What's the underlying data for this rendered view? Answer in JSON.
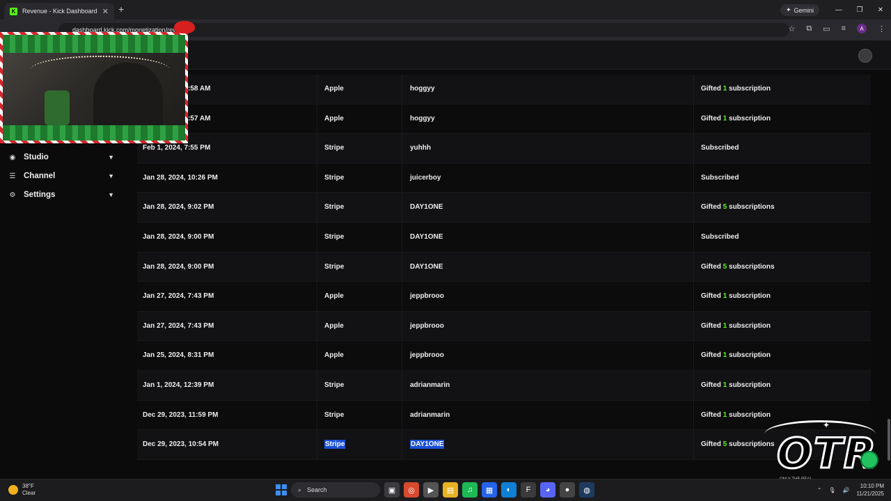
{
  "browser": {
    "tab_title": "Revenue - Kick Dashboard",
    "tab_favicon": "K",
    "url": "dashboard.kick.com/monetization/revenue",
    "gemini_label": "Gemini",
    "profile_initial": "A"
  },
  "sidebar": {
    "items": [
      {
        "label": "Studio",
        "icon": "studio-icon"
      },
      {
        "label": "Channel",
        "icon": "channel-icon"
      },
      {
        "label": "Settings",
        "icon": "gear-icon"
      }
    ]
  },
  "transactions": [
    {
      "date": "Feb 1, 2024, 8:58 AM",
      "payment": "Apple",
      "user": "hoggyy",
      "type_prefix": "Gifted ",
      "count": "1",
      "type_suffix": " subscription"
    },
    {
      "date": "Feb 1, 2024, 8:57 AM",
      "payment": "Apple",
      "user": "hoggyy",
      "type_prefix": "Gifted ",
      "count": "1",
      "type_suffix": " subscription"
    },
    {
      "date": "Feb 1, 2024, 7:55 PM",
      "payment": "Stripe",
      "user": "yuhhh",
      "type_prefix": "Subscribed",
      "count": "",
      "type_suffix": ""
    },
    {
      "date": "Jan 28, 2024, 10:26 PM",
      "payment": "Stripe",
      "user": "juicerboy",
      "type_prefix": "Subscribed",
      "count": "",
      "type_suffix": ""
    },
    {
      "date": "Jan 28, 2024, 9:02 PM",
      "payment": "Stripe",
      "user": "DAY1ONE",
      "type_prefix": "Gifted ",
      "count": "5",
      "type_suffix": " subscriptions"
    },
    {
      "date": "Jan 28, 2024, 9:00 PM",
      "payment": "Stripe",
      "user": "DAY1ONE",
      "type_prefix": "Subscribed",
      "count": "",
      "type_suffix": ""
    },
    {
      "date": "Jan 28, 2024, 9:00 PM",
      "payment": "Stripe",
      "user": "DAY1ONE",
      "type_prefix": "Gifted ",
      "count": "5",
      "type_suffix": " subscriptions"
    },
    {
      "date": "Jan 27, 2024, 7:43 PM",
      "payment": "Apple",
      "user": "jeppbrooo",
      "type_prefix": "Gifted ",
      "count": "1",
      "type_suffix": " subscription"
    },
    {
      "date": "Jan 27, 2024, 7:43 PM",
      "payment": "Apple",
      "user": "jeppbrooo",
      "type_prefix": "Gifted ",
      "count": "1",
      "type_suffix": " subscription"
    },
    {
      "date": "Jan 25, 2024, 8:31 PM",
      "payment": "Apple",
      "user": "jeppbrooo",
      "type_prefix": "Gifted ",
      "count": "1",
      "type_suffix": " subscription"
    },
    {
      "date": "Jan 1, 2024, 12:39 PM",
      "payment": "Stripe",
      "user": "adrianmarin",
      "type_prefix": "Gifted ",
      "count": "1",
      "type_suffix": " subscription"
    },
    {
      "date": "Dec 29, 2023, 11:59 PM",
      "payment": "Stripe",
      "user": "adrianmarin",
      "type_prefix": "Gifted ",
      "count": "1",
      "type_suffix": " subscription"
    },
    {
      "date": "Dec 29, 2023, 10:54 PM",
      "payment": "Stripe",
      "user": "DAY1ONE",
      "type_prefix": "Gifted ",
      "count": "5",
      "type_suffix": " subscriptions",
      "selected": true
    }
  ],
  "taskbar": {
    "weather_temp": "38°F",
    "weather_desc": "Clear",
    "search_label": "Search",
    "time": "10:10 PM",
    "date": "11/21/2025"
  },
  "overlay": {
    "logo_text": "OTR",
    "logo_tagline": "ONLY THE REAL"
  },
  "colors": {
    "accent": "#53fc18",
    "selection": "#1a4fd6"
  }
}
